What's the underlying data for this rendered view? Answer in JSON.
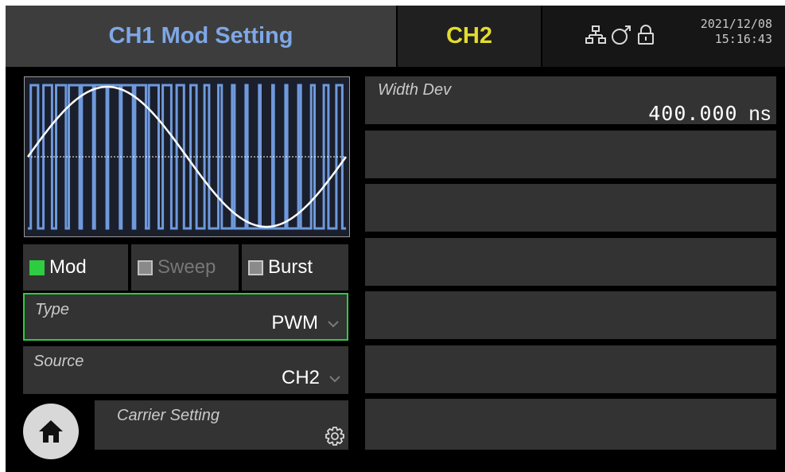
{
  "header": {
    "ch1_tab": "CH1 Mod Setting",
    "ch2_tab": "CH2",
    "date": "2021/12/08",
    "time": "15:16:43",
    "icons": [
      "network-icon",
      "usb-device-icon",
      "lock-icon"
    ]
  },
  "modes": [
    {
      "label": "Mod",
      "active": true
    },
    {
      "label": "Sweep",
      "active": false
    },
    {
      "label": "Burst",
      "active": false
    }
  ],
  "fields": {
    "type": {
      "label": "Type",
      "value": "PWM"
    },
    "source": {
      "label": "Source",
      "value": "CH2"
    },
    "carrier": {
      "label": "Carrier Setting"
    }
  },
  "right_panel": {
    "width_dev": {
      "label": "Width Dev",
      "value": "400.000",
      "unit": "ns"
    }
  },
  "colors": {
    "ch1": "#7ea7e6",
    "ch2": "#e3dc2e",
    "active_green": "#2ecc40",
    "pulse_blue": "#6f99dc"
  }
}
